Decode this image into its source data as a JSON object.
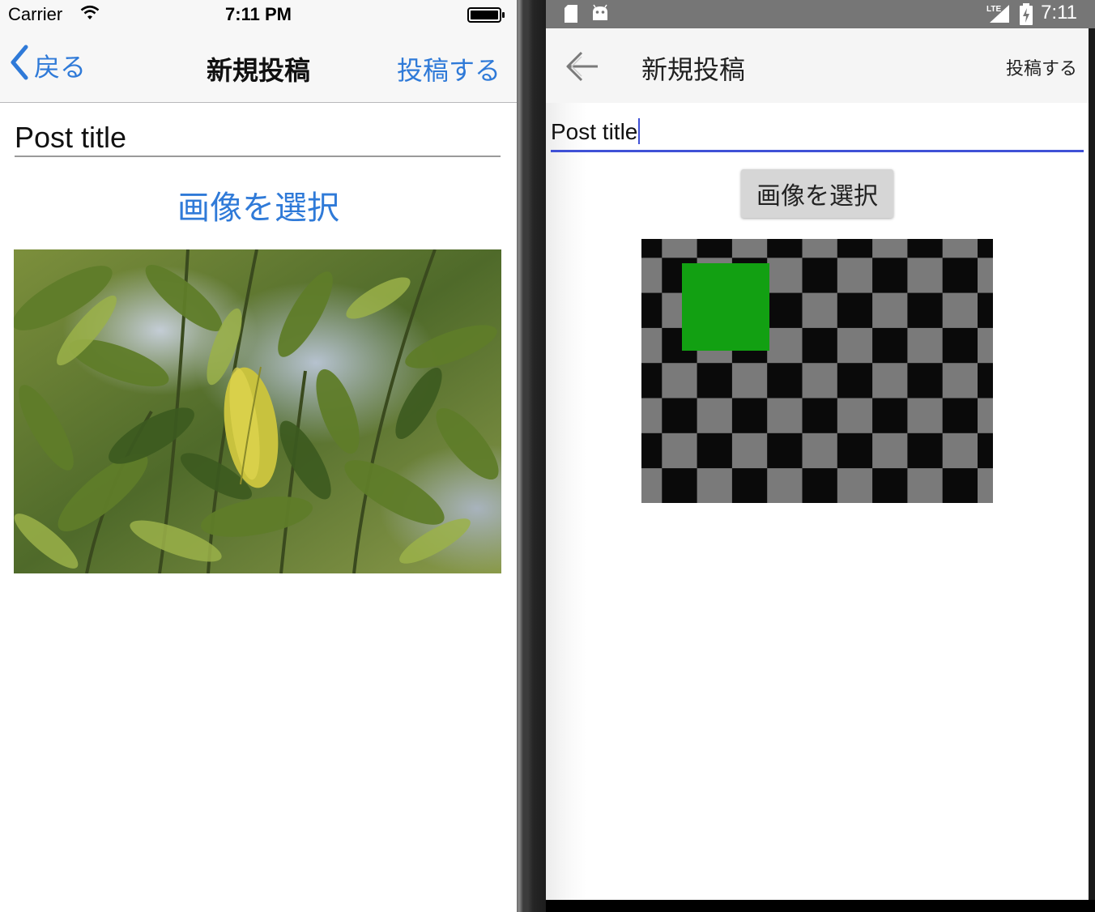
{
  "ios": {
    "status": {
      "carrier": "Carrier",
      "time": "7:11 PM"
    },
    "nav": {
      "back_label": "戻る",
      "title": "新規投稿",
      "post_label": "投稿する"
    },
    "form": {
      "title_value": "Post title",
      "select_image_label": "画像を選択"
    },
    "photo": {
      "subject": "green leaves photo"
    }
  },
  "android": {
    "status": {
      "time": "7:11",
      "network": "LTE"
    },
    "toolbar": {
      "title": "新規投稿",
      "post_label": "投稿する"
    },
    "form": {
      "title_value": "Post title",
      "select_image_label": "画像を選択"
    },
    "placeholder_image": {
      "pattern": "checkerboard",
      "colors": [
        "#0a0a0a",
        "#7a7a7a",
        "#12a012"
      ]
    }
  },
  "colors": {
    "ios_accent": "#2f7ad8",
    "android_accent": "#3f51d6"
  }
}
